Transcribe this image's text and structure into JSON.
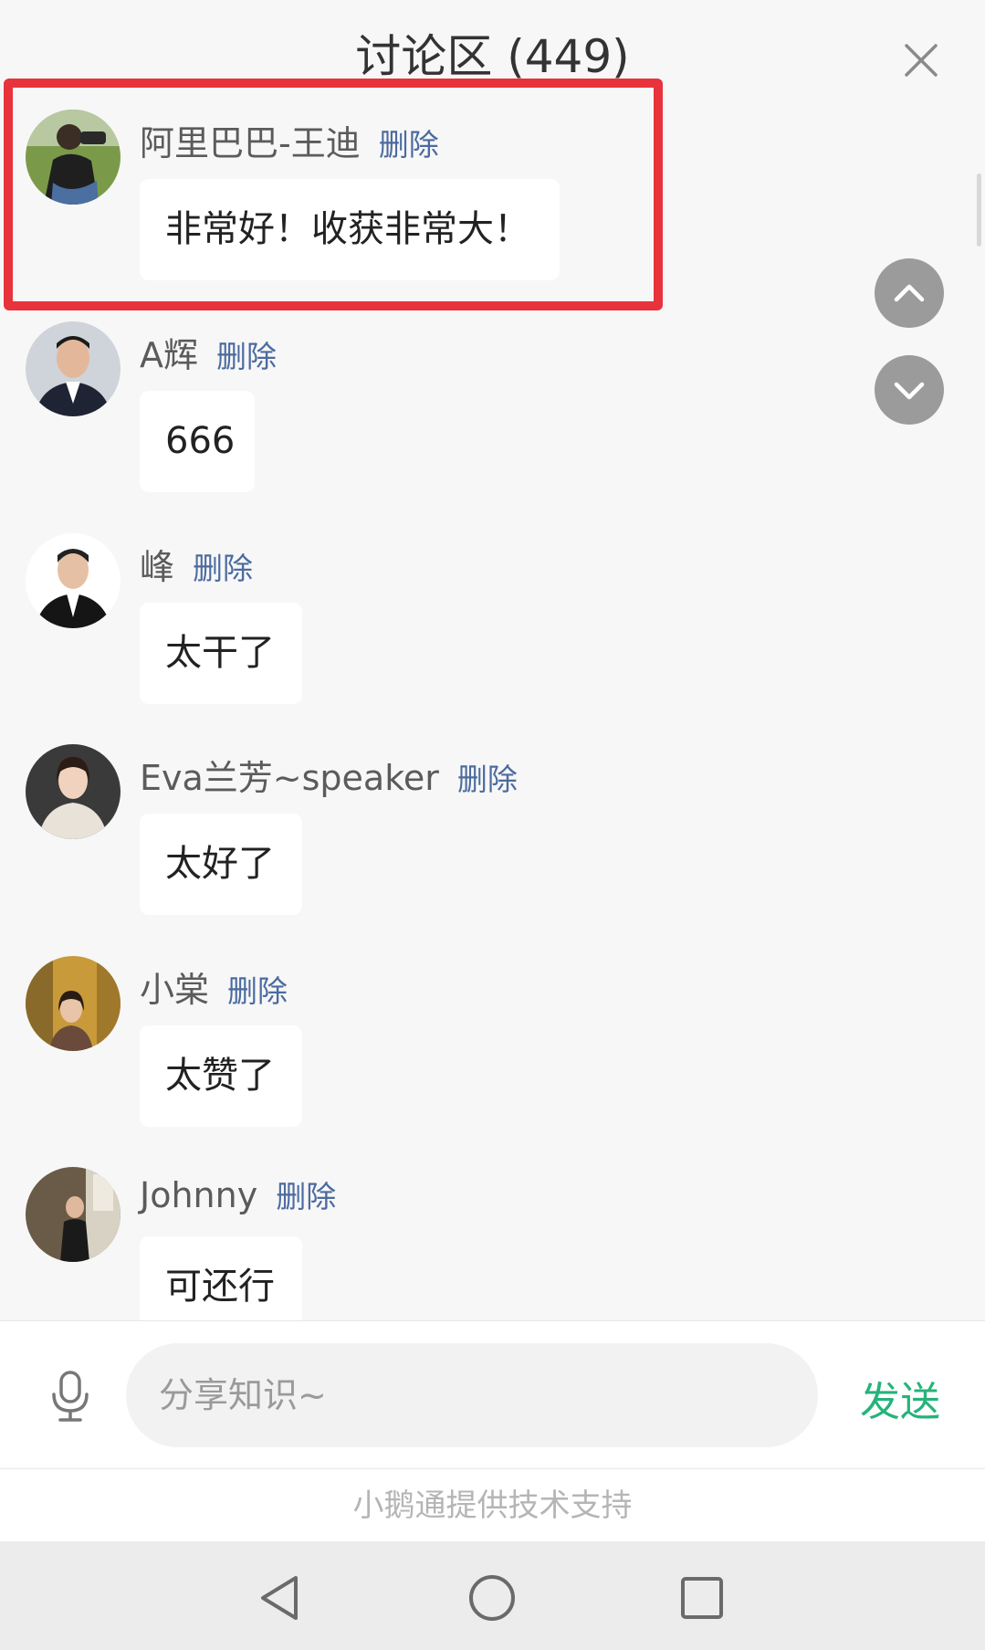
{
  "header": {
    "title": "讨论区 (449)"
  },
  "comments": [
    {
      "name": "阿里巴巴-王迪",
      "delete_label": "删除",
      "text": "非常好！收获非常大！"
    },
    {
      "name": "A辉",
      "delete_label": "删除",
      "text": "666"
    },
    {
      "name": "峰",
      "delete_label": "删除",
      "text": "太干了"
    },
    {
      "name": "Eva兰芳~speaker",
      "delete_label": "删除",
      "text": "太好了"
    },
    {
      "name": "小棠",
      "delete_label": "删除",
      "text": "太赞了"
    },
    {
      "name": "Johnny",
      "delete_label": "删除",
      "text": "可还行"
    }
  ],
  "composer": {
    "placeholder": "分享知识~",
    "send_label": "发送"
  },
  "footer": {
    "text": "小鹅通提供技术支持"
  },
  "icons": {
    "close": "close-icon",
    "scroll_up": "chevron-up-icon",
    "scroll_down": "chevron-down-icon",
    "mic": "microphone-icon",
    "nav_back": "triangle-back-icon",
    "nav_home": "circle-home-icon",
    "nav_recent": "square-recent-icon"
  },
  "colors": {
    "highlight": "#e8323c",
    "send": "#25b37a",
    "delete_link": "#4b6b9f",
    "background": "#f7f7f7"
  }
}
